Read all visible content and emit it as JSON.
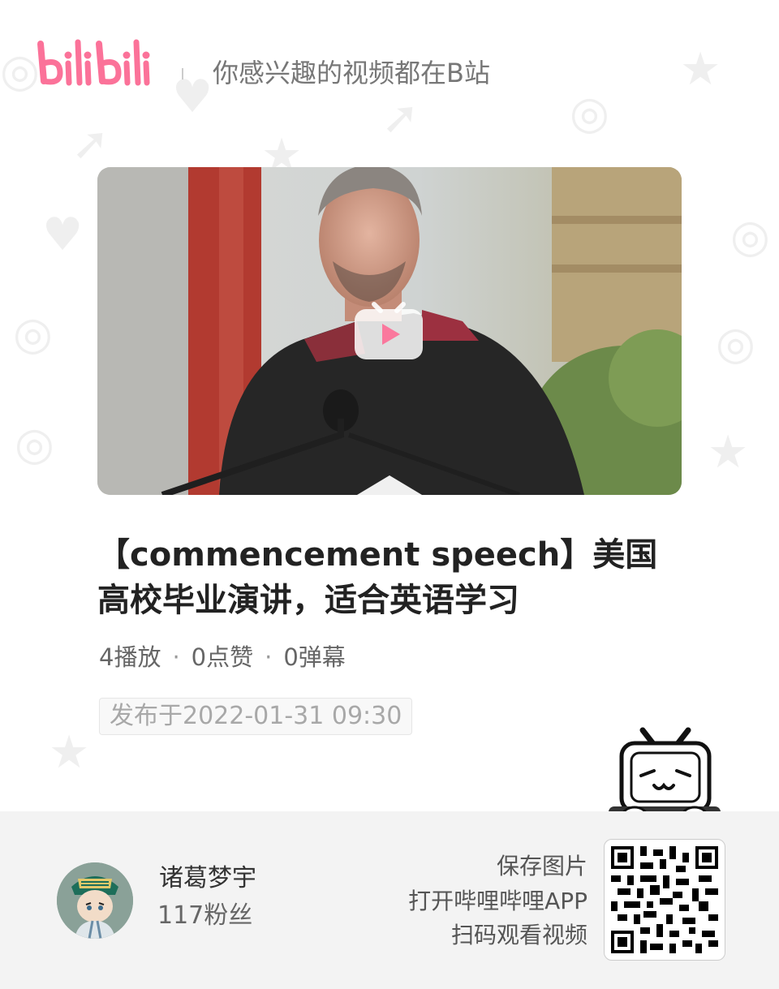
{
  "header": {
    "slogan": "你感兴趣的视频都在B站"
  },
  "video": {
    "title": "【commencement speech】美国高校毕业演讲，适合英语学习",
    "plays": "4播放",
    "likes": "0点赞",
    "danmaku": "0弹幕",
    "stats_separator": "·",
    "published": "发布于2022-01-31 09:30"
  },
  "uploader": {
    "name": "诸葛梦宇",
    "fans": "117粉丝"
  },
  "footer": {
    "hint_line1": "保存图片",
    "hint_line2": "打开哔哩哔哩APP",
    "hint_line3": "扫码观看视频"
  },
  "icons": {
    "logo": "bilibili-logo-icon",
    "play": "play-icon",
    "mascot": "tv-mascot-icon",
    "qr": "qr-code-icon"
  },
  "colors": {
    "brand_pink": "#fb7299",
    "footer_bg": "#f3f3f3"
  }
}
